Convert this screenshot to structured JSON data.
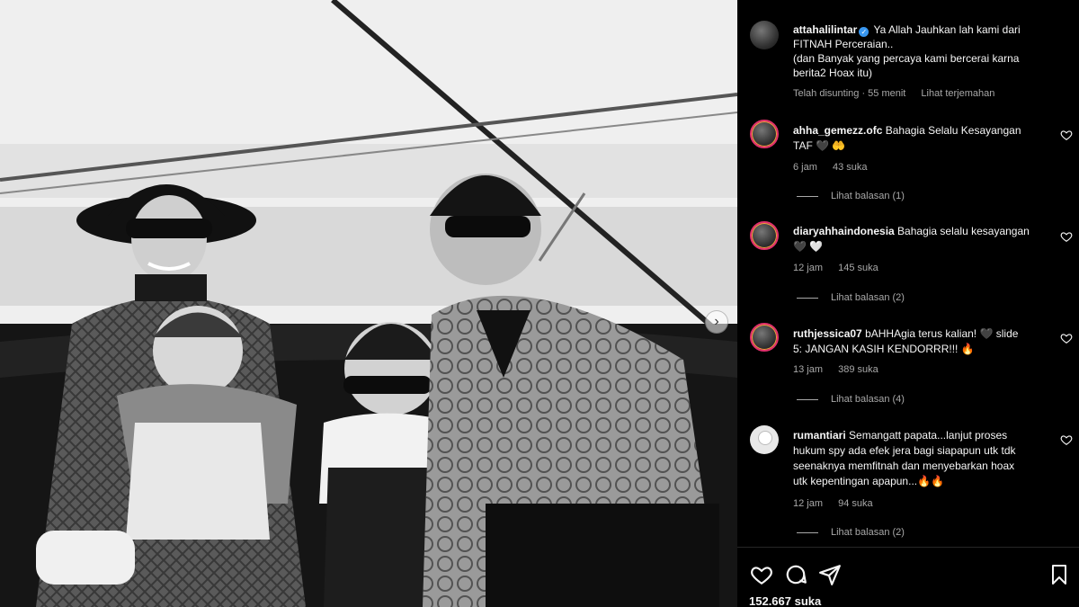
{
  "post": {
    "username": "attahalilintar",
    "caption_lines": [
      "Ya Allah Jauhkan lah kami dari",
      "FITNAH Perceraian..",
      "(dan Banyak yang percaya kami bercerai karna",
      "berita2 Hoax itu)"
    ],
    "edited": "Telah disunting · 55 menit",
    "translate": "Lihat terjemahan",
    "likes": "152.667 suka"
  },
  "comments": [
    {
      "username": "ahha_gemezz.ofc",
      "text_line1": "Bahagia Selalu Kesayangan",
      "text_line2": "TAF 🖤 🤲",
      "time": "6 jam",
      "likes": "43 suka",
      "replies": "Lihat balasan (1)"
    },
    {
      "username": "diaryahhaindonesia",
      "text_line1": "Bahagia selalu kesayangan",
      "text_line2": "🖤 🤍",
      "time": "12 jam",
      "likes": "145 suka",
      "replies": "Lihat balasan (2)"
    },
    {
      "username": "ruthjessica07",
      "text_line1": "bAHHAgia terus kalian! 🖤 slide",
      "text_line2": "5: JANGAN KASIH KENDORRR!!! 🔥",
      "time": "13 jam",
      "likes": "389 suka",
      "replies": "Lihat balasan (4)"
    },
    {
      "username": "rumantiari",
      "text_line1": "Semangatt papata...lanjut proses",
      "text_line2": "hukum spy ada efek jera bagi siapapun utk tdk",
      "text_line3": "seenaknya memfitnah dan menyebarkan hoax",
      "text_line4": "utk kepentingan apapun...🔥🔥",
      "time": "12 jam",
      "likes": "94 suka",
      "replies": "Lihat balasan (2)"
    }
  ],
  "icons": {
    "verified": "verified-badge-icon",
    "heart": "heart-icon",
    "comment": "comment-icon",
    "share": "share-icon",
    "save": "bookmark-icon",
    "next": "chevron-right-icon"
  },
  "colors": {
    "background": "#000000",
    "text": "#f5f5f5",
    "muted": "#a8a8a8",
    "verified": "#3897f0"
  }
}
